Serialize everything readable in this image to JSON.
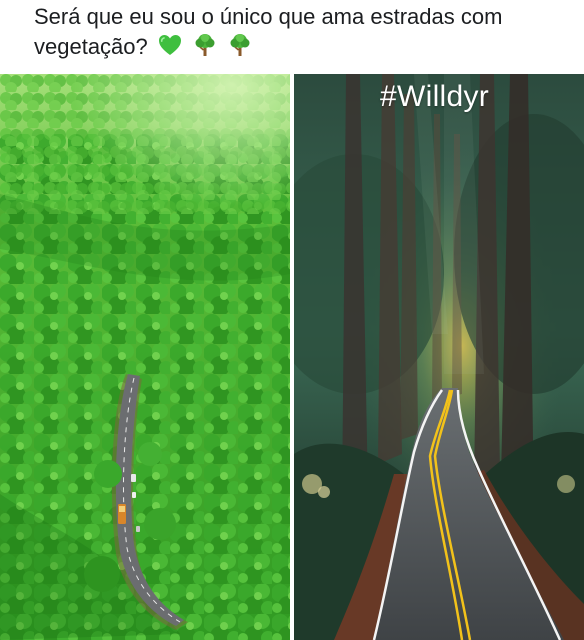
{
  "post": {
    "caption": "Será que eu sou o único que ama estradas com vegetação?",
    "emojis": [
      "green-heart-icon",
      "deciduous-tree-icon",
      "deciduous-tree-icon"
    ]
  },
  "photos": {
    "left": {
      "subject": "aerial-forest-road-photo"
    },
    "right": {
      "subject": "redwood-forest-road-photo",
      "watermark": "#Willdyr"
    }
  },
  "colors": {
    "foliage": "#3fa82a",
    "foliage_light": "#7ed24a",
    "forest_dark": "#1e3a2a",
    "road": "#4a4d52",
    "road_line_yellow": "#f2c21a",
    "road_line_white": "#ffffff"
  }
}
